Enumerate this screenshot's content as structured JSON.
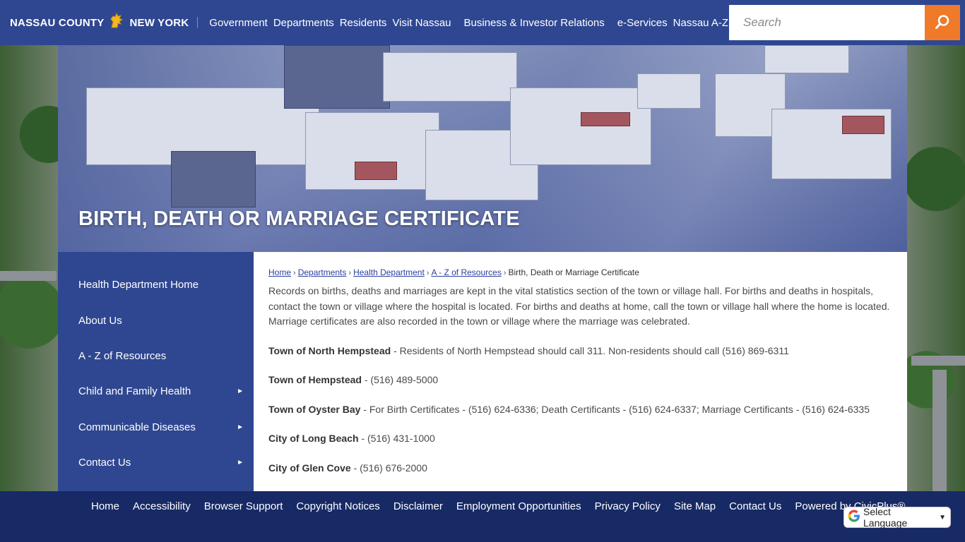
{
  "header": {
    "logo_left": "NASSAU COUNTY",
    "logo_right": "NEW YORK",
    "nav": [
      "Government",
      "Departments",
      "Residents",
      "Visit Nassau",
      "Business & Investor Relations",
      "e-Services",
      "Nassau A-Z"
    ],
    "search_placeholder": "Search"
  },
  "banner": {
    "title": "BIRTH, DEATH OR MARRIAGE CERTIFICATE"
  },
  "sidenav": {
    "items": [
      {
        "label": "Health Department Home",
        "has_submenu": false
      },
      {
        "label": "About Us",
        "has_submenu": false
      },
      {
        "label": "A - Z of Resources",
        "has_submenu": false
      },
      {
        "label": "Child and Family Health",
        "has_submenu": true
      },
      {
        "label": "Communicable Diseases",
        "has_submenu": true
      },
      {
        "label": "Contact Us",
        "has_submenu": true
      }
    ]
  },
  "breadcrumb": {
    "links": [
      "Home",
      "Departments",
      "Health Department",
      "A - Z of Resources"
    ],
    "current": "Birth, Death or Marriage Certificate"
  },
  "content": {
    "intro": "Records on births, deaths and marriages are kept in the vital statistics section of the town or village hall. For births and deaths in hospitals, contact the town or village where the hospital is located. For births and deaths at home, call the town or village hall where the home is located. Marriage certificates are also recorded in the town or village where the marriage was celebrated.",
    "entries": [
      {
        "name": "Town of North Hempstead",
        "detail": " - Residents of North Hempstead should call 311. Non-residents should call (516) 869-6311"
      },
      {
        "name": "Town of Hempstead",
        "detail": " - (516) 489-5000"
      },
      {
        "name": "Town of Oyster Bay",
        "detail": " - For Birth Certificates - (516) 624-6336; Death Certificants - (516) 624-6337; Marriage Certificants - (516) 624-6335"
      },
      {
        "name": "City of Long Beach",
        "detail": " - (516) 431-1000"
      },
      {
        "name": "City of Glen Cove",
        "detail": " - (516) 676-2000"
      }
    ]
  },
  "footer": {
    "links": [
      "Home",
      "Accessibility",
      "Browser Support",
      "Copyright Notices",
      "Disclaimer",
      "Employment Opportunities",
      "Privacy Policy",
      "Site Map",
      "Contact Us",
      "Powered by CivicPlus®"
    ]
  },
  "translate": {
    "label": "Select Language"
  },
  "colors": {
    "header_bg": "#2f4791",
    "footer_bg": "#172a66",
    "search_button": "#ef7a2a",
    "link": "#2a3fa0"
  },
  "icons": {
    "logo": "lion-icon",
    "search": "search-icon",
    "submenu": "arrow-right-icon",
    "translate": "google-icon"
  }
}
